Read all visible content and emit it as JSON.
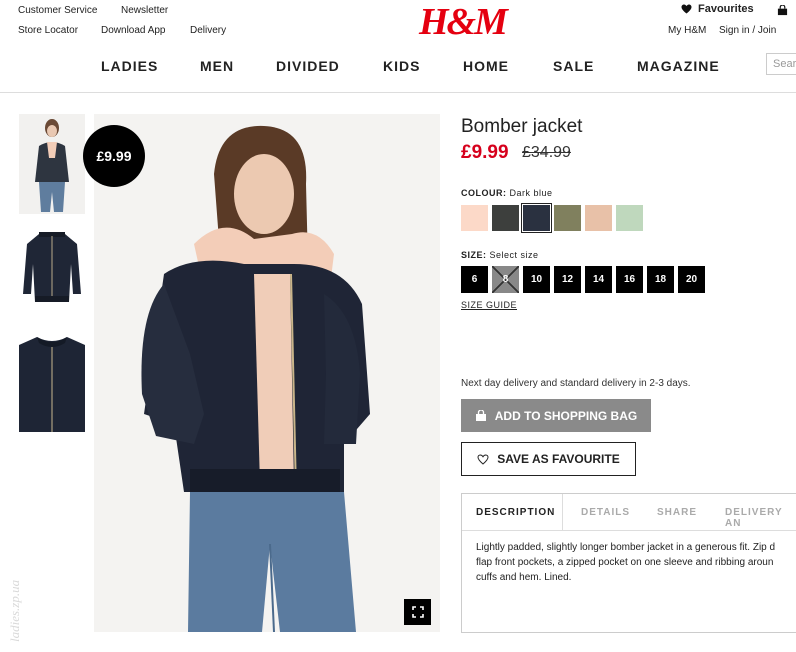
{
  "header": {
    "links_left_row1": [
      "Customer Service",
      "Newsletter"
    ],
    "links_left_row2": [
      "Store Locator",
      "Download App",
      "Delivery"
    ],
    "logo": "H&M",
    "favourites": "Favourites",
    "my_hm": "My H&M",
    "sign_in": "Sign in / Join",
    "search_placeholder": "Sear"
  },
  "nav": [
    "LADIES",
    "MEN",
    "DIVIDED",
    "KIDS",
    "HOME",
    "SALE",
    "MAGAZINE"
  ],
  "product": {
    "badge_price": "£9.99",
    "title": "Bomber jacket",
    "price": "£9.99",
    "old_price": "£34.99",
    "colour_label": "COLOUR:",
    "colour_value": "Dark blue",
    "swatches": [
      "#fcd9c8",
      "#3d3f3d",
      "#2a3140",
      "#80805e",
      "#e8c1a8",
      "#bfd8bd"
    ],
    "selected_swatch": 2,
    "size_label": "SIZE:",
    "size_value": "Select size",
    "sizes": [
      "6",
      "8",
      "10",
      "12",
      "14",
      "16",
      "18",
      "20"
    ],
    "unavailable_size": 1,
    "size_guide": "SIZE GUIDE",
    "delivery_text": "Next day delivery and standard delivery in 2-3 days.",
    "add_to_bag": "ADD TO SHOPPING BAG",
    "save_favourite": "SAVE AS FAVOURITE"
  },
  "tabs": [
    "DESCRIPTION",
    "DETAILS",
    "SHARE",
    "DELIVERY AN"
  ],
  "description": "Lightly padded, slightly longer bomber jacket in a generous fit. Zip d flap front pockets, a zipped pocket on one sleeve and ribbing aroun cuffs and hem. Lined.",
  "description_lines": [
    "Lightly padded, slightly longer bomber jacket in a generous fit. Zip d",
    "flap front pockets, a zipped pocket on one sleeve and ribbing aroun",
    "cuffs and hem. Lined."
  ],
  "watermark": "ladies.zp.ua",
  "colors": {
    "brand": "#e50010",
    "sale_price": "#d6001c",
    "button_grey": "#8a8a8a"
  }
}
